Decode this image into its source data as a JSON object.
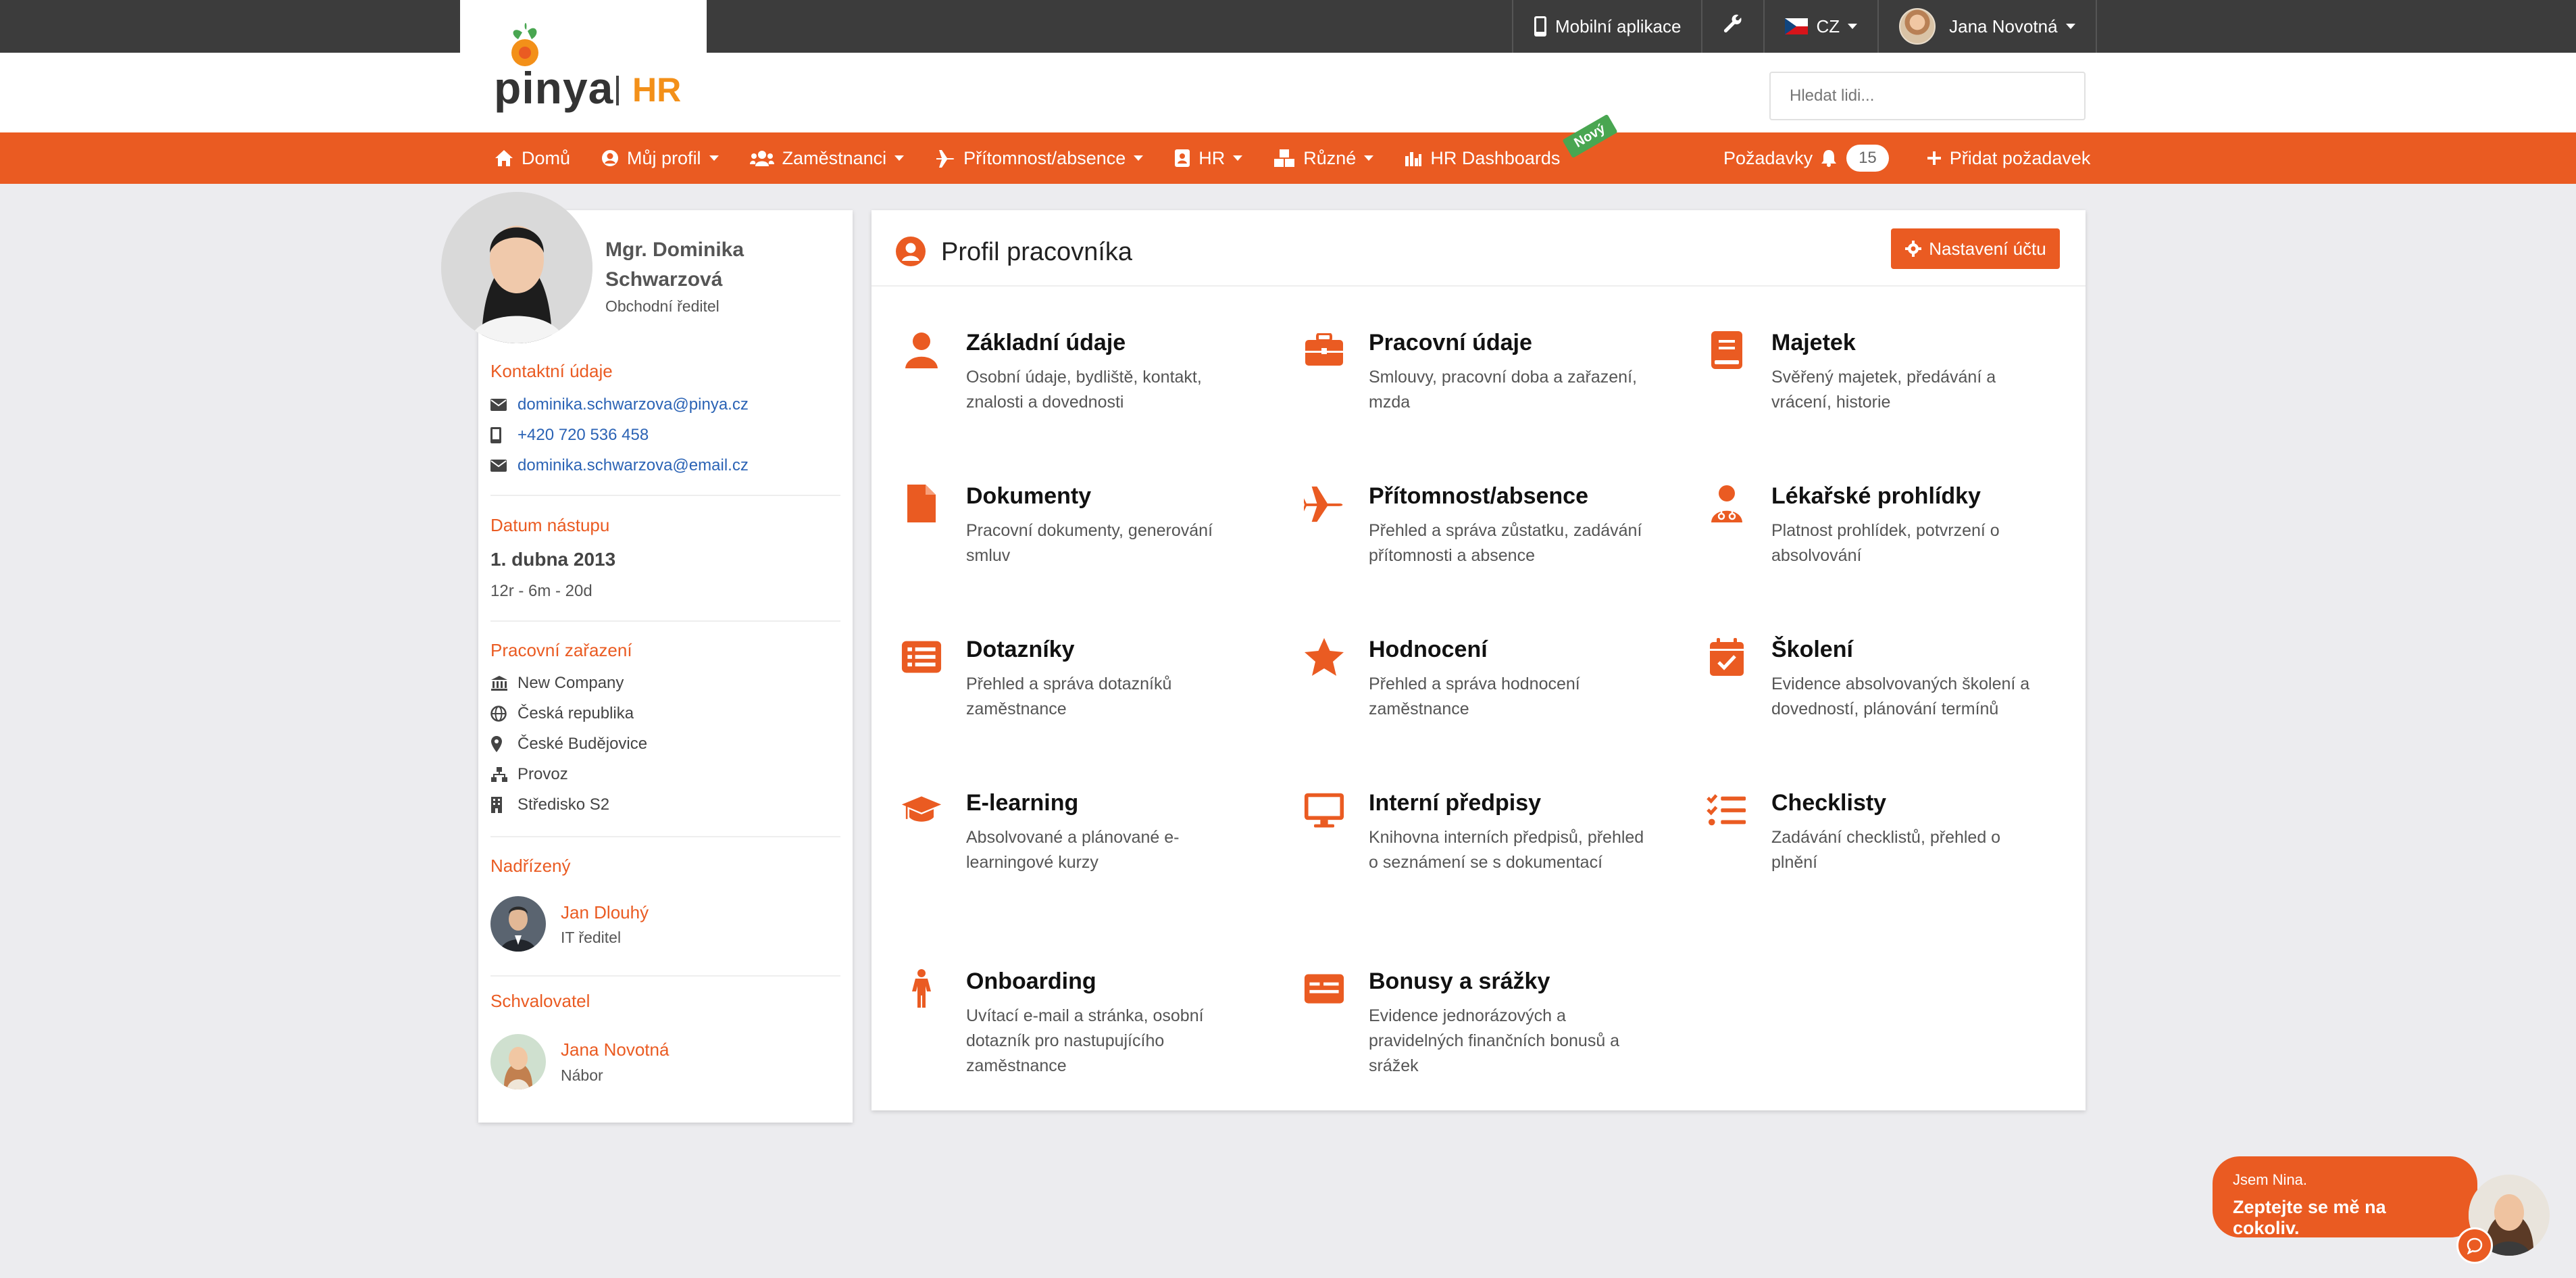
{
  "topbar": {
    "mobile_app": "Mobilní aplikace",
    "language": "CZ",
    "user": "Jana Novotná"
  },
  "header": {
    "logo_text": "pinya",
    "logo_hr": "HR",
    "search_placeholder": "Hledat lidi..."
  },
  "nav": {
    "items": [
      "Domů",
      "Můj profil",
      "Zaměstnanci",
      "Přítomnost/absence",
      "HR",
      "Různé",
      "HR Dashboards"
    ],
    "new_badge": "Nový",
    "requests": "Požadavky",
    "requests_count": "15",
    "add_request": "Přidat požadavek"
  },
  "profile": {
    "name": "Mgr. Dominika Schwarzová",
    "role": "Obchodní ředitel",
    "contact_title": "Kontaktní údaje",
    "email1": "dominika.schwarzova@pinya.cz",
    "phone": "+420 720 536 458",
    "email2": "dominika.schwarzova@email.cz",
    "start_title": "Datum nástupu",
    "start_date": "1. dubna 2013",
    "duration": "12r - 6m - 20d",
    "position_title": "Pracovní zařazení",
    "company": "New Company",
    "country": "Česká republika",
    "city": "České Budějovice",
    "department": "Provoz",
    "center": "Středisko S2",
    "superior_title": "Nadřízený",
    "superior_name": "Jan Dlouhý",
    "superior_role": "IT ředitel",
    "approver_title": "Schvalovatel",
    "approver_name": "Jana Novotná",
    "approver_role": "Nábor"
  },
  "main": {
    "title": "Profil pracovníka",
    "settings_button": "Nastavení účtu",
    "tiles": [
      {
        "title": "Základní údaje",
        "desc": "Osobní údaje, bydliště, kontakt, znalosti a dovednosti",
        "icon": "user-icon"
      },
      {
        "title": "Pracovní údaje",
        "desc": "Smlouvy, pracovní doba a zařazení, mzda",
        "icon": "briefcase-icon"
      },
      {
        "title": "Majetek",
        "desc": "Svěřený majetek, předávání a vrácení, historie",
        "icon": "book-icon"
      },
      {
        "title": "Dokumenty",
        "desc": "Pracovní dokumenty, generování smluv",
        "icon": "file-icon"
      },
      {
        "title": "Přítomnost/absence",
        "desc": "Přehled a správa zůstatku, zadávání přítomnosti a absence",
        "icon": "plane-icon"
      },
      {
        "title": "Lékařské prohlídky",
        "desc": "Platnost prohlídek, potvrzení o absolvování",
        "icon": "doctor-icon"
      },
      {
        "title": "Dotazníky",
        "desc": "Přehled a správa dotazníků zaměstnance",
        "icon": "list-icon"
      },
      {
        "title": "Hodnocení",
        "desc": "Přehled a správa hodnocení zaměstnance",
        "icon": "star-icon"
      },
      {
        "title": "Školení",
        "desc": "Evidence absolvovaných školení a dovedností, plánování termínů",
        "icon": "calendar-check-icon"
      },
      {
        "title": "E-learning",
        "desc": "Absolvované a plánované e-learningové kurzy",
        "icon": "graduation-cap-icon"
      },
      {
        "title": "Interní předpisy",
        "desc": "Knihovna interních předpisů, přehled o seznámení se s dokumentací",
        "icon": "monitor-icon"
      },
      {
        "title": "Checklisty",
        "desc": "Zadávání checklistů, přehled o plnění",
        "icon": "checklist-icon"
      },
      {
        "title": "Onboarding",
        "desc": "Uvítací e-mail a stránka, osobní dotazník pro nastupujícího zaměstnance",
        "icon": "person-icon"
      },
      {
        "title": "Bonusy a srážky",
        "desc": "Evidence jednorázových a pravidelných finančních bonusů a srážek",
        "icon": "money-card-icon"
      }
    ]
  },
  "chat": {
    "line1": "Jsem Nina.",
    "line2": "Zeptejte se mě na cokoliv."
  },
  "colors": {
    "accent": "#ea5b22",
    "topbar": "#3c3c3c",
    "new_badge": "#49a651"
  }
}
